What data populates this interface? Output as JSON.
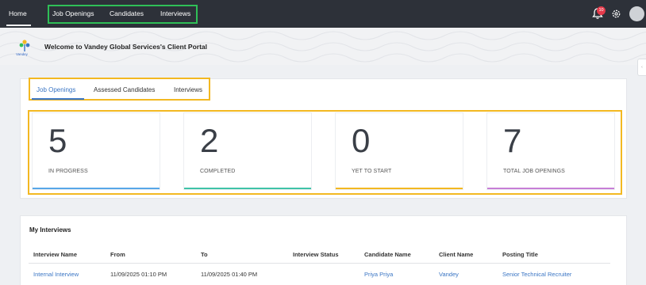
{
  "nav": {
    "home": "Home",
    "job_openings": "Job Openings",
    "candidates": "Candidates",
    "interviews": "Interviews",
    "notification_count": "10",
    "icons": [
      "bell-icon",
      "gear-icon",
      "avatar"
    ]
  },
  "banner": {
    "logo_text": "Vandey",
    "welcome": "Welcome to Vandey Global Services's Client Portal"
  },
  "tabs": {
    "job_openings": "Job Openings",
    "assessed_candidates": "Assessed Candidates",
    "interviews": "Interviews"
  },
  "stats": [
    {
      "value": "5",
      "label": "IN PROGRESS",
      "color": "#57a7e8"
    },
    {
      "value": "2",
      "label": "COMPLETED",
      "color": "#3fc3a8"
    },
    {
      "value": "0",
      "label": "YET TO START",
      "color": "#f3b821"
    },
    {
      "value": "7",
      "label": "TOTAL JOB OPENINGS",
      "color": "#c77ed6"
    }
  ],
  "my_interviews": {
    "title": "My Interviews",
    "columns": [
      "Interview Name",
      "From",
      "To",
      "Interview Status",
      "Candidate Name",
      "Client Name",
      "Posting Title"
    ],
    "rows": [
      {
        "interview_name": "Internal Interview",
        "from": "11/09/2025 01:10 PM",
        "to": "11/09/2025 01:40 PM",
        "status": "",
        "candidate_name": "Priya Priya",
        "client_name": "Vandey",
        "posting_title": "Senior Technical Recruiter"
      }
    ]
  },
  "colors": {
    "nav_bg": "#2d3139",
    "accent_blue": "#3a75c4",
    "highlight_green": "#2fbf57",
    "highlight_yellow": "#f3b821"
  }
}
